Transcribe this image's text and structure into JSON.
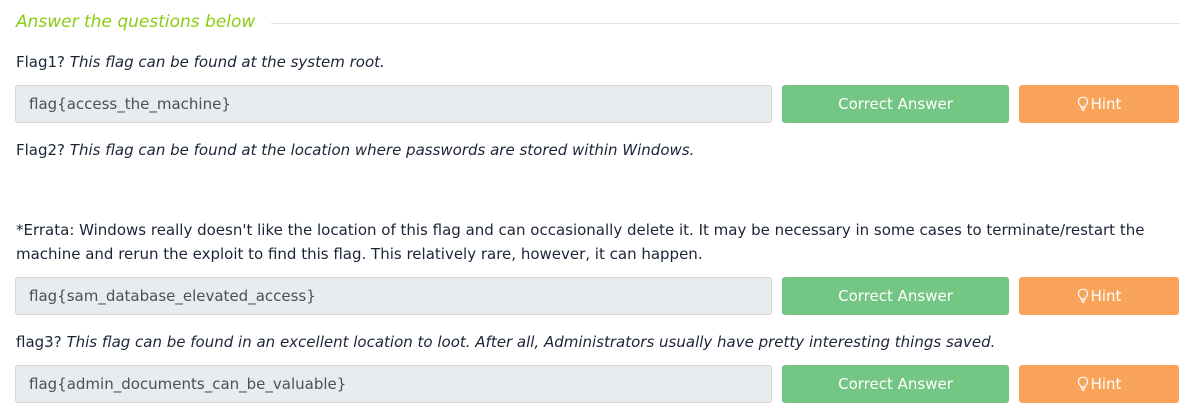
{
  "section": {
    "title": "Answer the questions below"
  },
  "questions": [
    {
      "label": "Flag1?",
      "description": "This flag can be found at the system root.",
      "answer": "flag{access_the_machine}",
      "status_label": "Correct Answer",
      "hint_label": "Hint"
    },
    {
      "label": "Flag2?",
      "description": "This flag can be found at the location where passwords are stored within Windows.",
      "errata": "*Errata: Windows really doesn't like the location of this flag and can occasionally delete it. It may be necessary in some cases to terminate/restart the machine and rerun the exploit to find this flag. This relatively rare, however, it can happen.",
      "answer": "flag{sam_database_elevated_access}",
      "status_label": "Correct Answer",
      "hint_label": "Hint"
    },
    {
      "label": "flag3?",
      "description": "This flag can be found in an excellent location to loot. After all, Administrators usually have pretty interesting things saved.",
      "answer": "flag{admin_documents_can_be_valuable}",
      "status_label": "Correct Answer",
      "hint_label": "Hint"
    }
  ],
  "colors": {
    "title": "#88cc14",
    "correct": "#74c685",
    "hint": "#f9a35b",
    "input_bg": "#e9ecef"
  },
  "icons": {
    "hint": "lightbulb-icon"
  }
}
